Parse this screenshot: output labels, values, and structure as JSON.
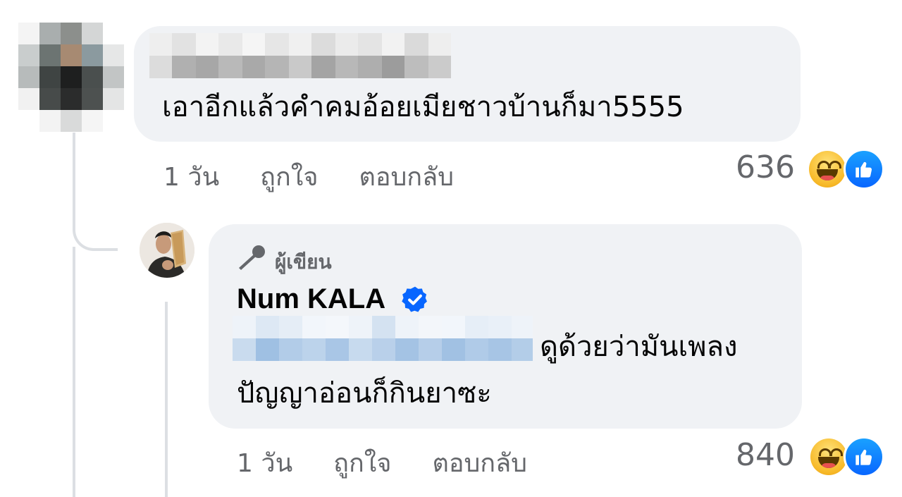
{
  "comment": {
    "text": "เอาอีกแล้วคำคมอ้อยเมียชาวบ้านก็มา5555",
    "time": "1 วัน",
    "like_label": "ถูกใจ",
    "reply_label": "ตอบกลับ",
    "reaction_count": "636"
  },
  "reply": {
    "badge_label": "ผู้เขียน",
    "author_name": "Num KALA",
    "text_line1": "ดูด้วยว่ามันเพลง",
    "text_line2": "ปัญญาอ่อนก็กินยาซะ",
    "time": "1 วัน",
    "like_label": "ถูกใจ",
    "reply_label": "ตอบกลับ",
    "reaction_count": "840"
  },
  "icons": {
    "reactions": [
      "haha-icon",
      "like-icon"
    ],
    "author_badge": "microphone-icon",
    "verified": "verified-badge-icon"
  },
  "colors": {
    "bubble": "#f0f2f5",
    "secondary_text": "#65676b",
    "like_blue": "#0866ff",
    "haha_yellow": "#f7b928",
    "verified_blue": "#0866ff"
  }
}
